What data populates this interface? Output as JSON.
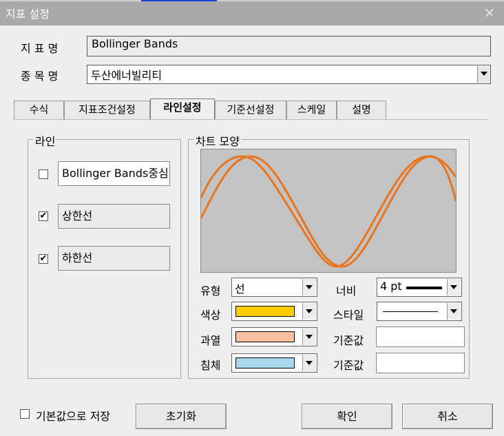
{
  "window": {
    "title": "지표 설정"
  },
  "form": {
    "indicator_label": "지 표 명",
    "indicator_value": "Bollinger Bands",
    "symbol_label": "종 목 명",
    "symbol_value": "두산에너빌리티"
  },
  "tabs": [
    {
      "label": "수식",
      "active": false
    },
    {
      "label": "지표조건설정",
      "active": false
    },
    {
      "label": "라인설정",
      "active": true
    },
    {
      "label": "기준선설정",
      "active": false
    },
    {
      "label": "스케일",
      "active": false
    },
    {
      "label": "설명",
      "active": false
    }
  ],
  "lines_group": {
    "title": "라인",
    "items": [
      {
        "label": "Bollinger Bands중심",
        "checked": false
      },
      {
        "label": "상한선",
        "checked": true
      },
      {
        "label": "하한선",
        "checked": true
      }
    ]
  },
  "chart_group": {
    "title": "차트 모양",
    "preview_line_color": "#e8741e",
    "preview_background": "#c3c3c3",
    "type_label": "유형",
    "type_value": "선",
    "width_label": "너비",
    "width_value": "4 pt",
    "color_label": "색상",
    "color_value": "#ffcc00",
    "style_label": "스타일",
    "overheat_label": "과열",
    "overheat_color": "#f8c0a0",
    "overheat_ref_label": "기준값",
    "slump_label": "침체",
    "slump_color": "#a8d8f0",
    "slump_ref_label": "기준값"
  },
  "footer": {
    "save_default_label": "기본값으로 저장",
    "reset_button": "초기화",
    "ok_button": "확인",
    "cancel_button": "취소"
  },
  "icons": {
    "close": "×",
    "check": "✔"
  }
}
